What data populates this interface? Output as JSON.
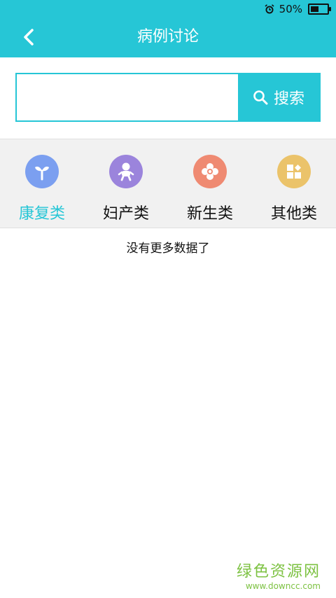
{
  "status": {
    "battery_text": "50%",
    "battery_level": 0.5,
    "icons": [
      "alarm-icon",
      "battery-icon"
    ]
  },
  "header": {
    "title": "病例讨论",
    "back_icon": "chevron-left-icon",
    "color": "#26c6d6"
  },
  "search": {
    "value": "",
    "placeholder": "",
    "button_label": "搜索",
    "button_icon": "search-icon"
  },
  "categories": [
    {
      "label": "康复类",
      "icon": "sprout-icon",
      "color": "#7b9ff0",
      "active": true
    },
    {
      "label": "妇产类",
      "icon": "baby-icon",
      "color": "#9b84dc",
      "active": false
    },
    {
      "label": "新生类",
      "icon": "flower-icon",
      "color": "#ef8a72",
      "active": false
    },
    {
      "label": "其他类",
      "icon": "grid-icon",
      "color": "#ebc36a",
      "active": false
    }
  ],
  "list": {
    "empty_text": "没有更多数据了"
  },
  "watermark": {
    "line1": "绿色资源网",
    "line2": "www.downcc.com"
  }
}
